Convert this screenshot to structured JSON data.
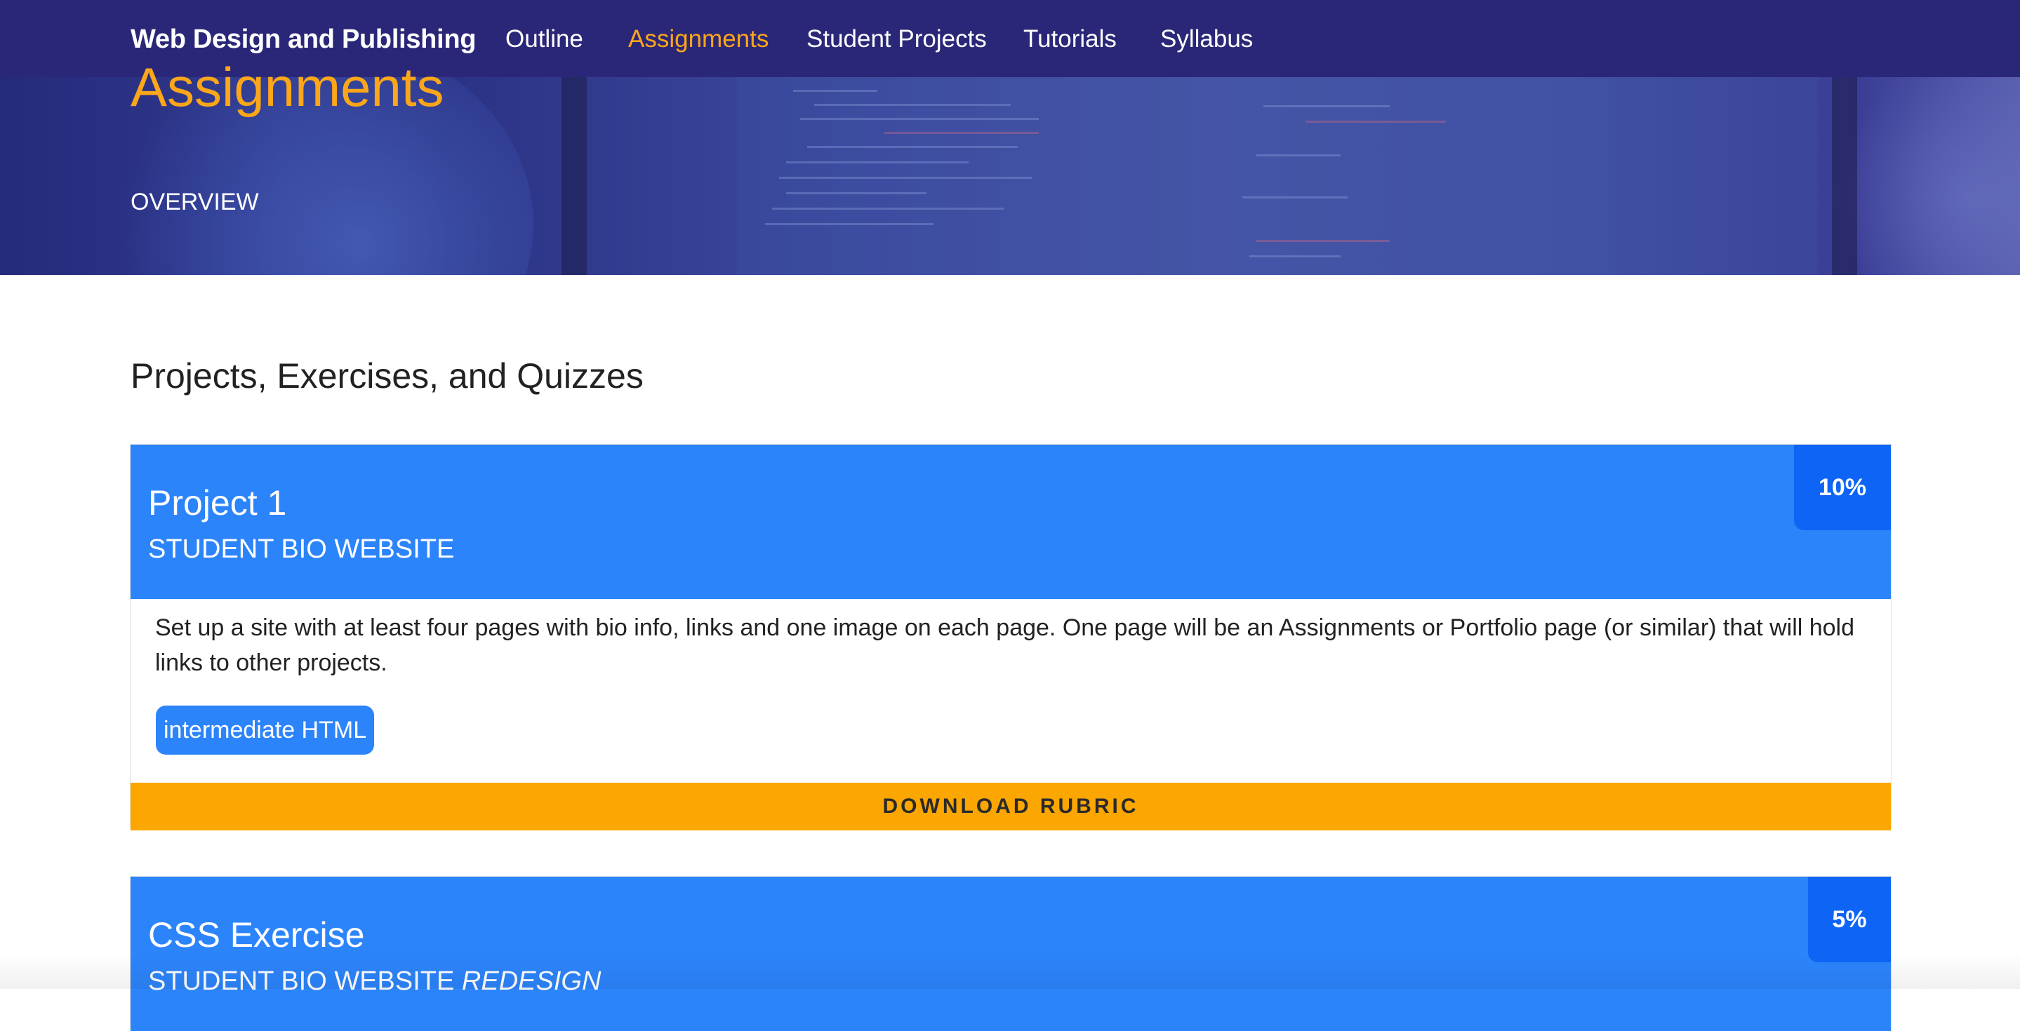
{
  "navbar": {
    "brand": "Web Design and Publishing",
    "items": [
      {
        "label": "Outline",
        "active": false
      },
      {
        "label": "Assignments",
        "active": true
      },
      {
        "label": "Student Projects",
        "active": false
      },
      {
        "label": "Tutorials",
        "active": false
      },
      {
        "label": "Syllabus",
        "active": false
      }
    ]
  },
  "hero": {
    "title": "Assignments",
    "subtitle": "OVERVIEW"
  },
  "main": {
    "heading": "Projects, Exercises, and Quizzes",
    "cards": [
      {
        "title": "Project 1",
        "subtitle": "STUDENT BIO WEBSITE",
        "weight": "10%",
        "description": "Set up a site with at least four pages with bio info, links and one image on each page. One page will be an Assignments or Portfolio page (or similar) that will hold links to other projects.",
        "tag": "intermediate HTML",
        "button": "DOWNLOAD RUBRIC"
      },
      {
        "title": "CSS Exercise",
        "subtitle": "STUDENT BIO WEBSITE",
        "subtitle_em": "REDESIGN",
        "weight": "5%"
      }
    ]
  },
  "colors": {
    "navbar": "#2b2778",
    "accent_orange": "#fca619",
    "card_header": "#2c84fb",
    "badge": "#0e65f5",
    "rubric_button": "#fca601"
  }
}
